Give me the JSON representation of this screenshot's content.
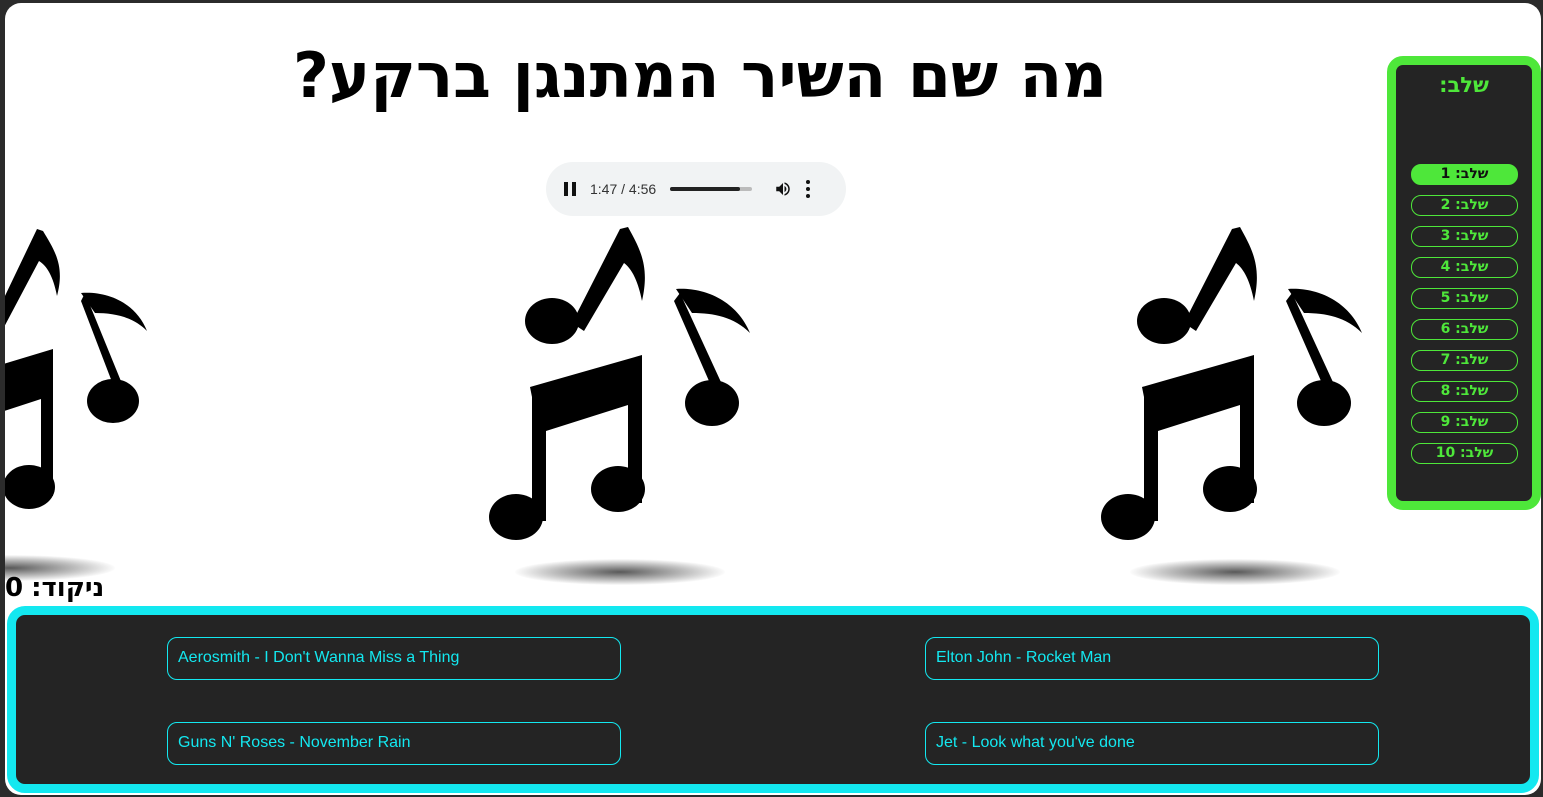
{
  "question": "מה שם השיר המתנגן ברקע?",
  "audio": {
    "current_time": "1:47",
    "duration": "4:56",
    "time_text": "1:47 / 4:56",
    "progress": 0.85,
    "icons": [
      "pause-icon",
      "volume-icon",
      "more-options-icon"
    ]
  },
  "background_icon": "music-notes-icon",
  "score": {
    "label": "ניקוד:",
    "value": "0"
  },
  "levels": {
    "title": "שלב:",
    "items": [
      {
        "label": "שלב: 1",
        "active": true
      },
      {
        "label": "שלב: 2",
        "active": false
      },
      {
        "label": "שלב: 3",
        "active": false
      },
      {
        "label": "שלב: 4",
        "active": false
      },
      {
        "label": "שלב: 5",
        "active": false
      },
      {
        "label": "שלב: 6",
        "active": false
      },
      {
        "label": "שלב: 7",
        "active": false
      },
      {
        "label": "שלב: 8",
        "active": false
      },
      {
        "label": "שלב: 9",
        "active": false
      },
      {
        "label": "שלב: 10",
        "active": false
      }
    ]
  },
  "answers": [
    "Aerosmith - I Don't Wanna Miss a Thing",
    "Elton John - Rocket Man",
    "Guns N' Roses - November Rain",
    "Jet - Look what you've done"
  ],
  "colors": {
    "levels_accent": "#4ee73a",
    "answers_accent": "#13e8f0",
    "panel_bg": "#242424"
  }
}
